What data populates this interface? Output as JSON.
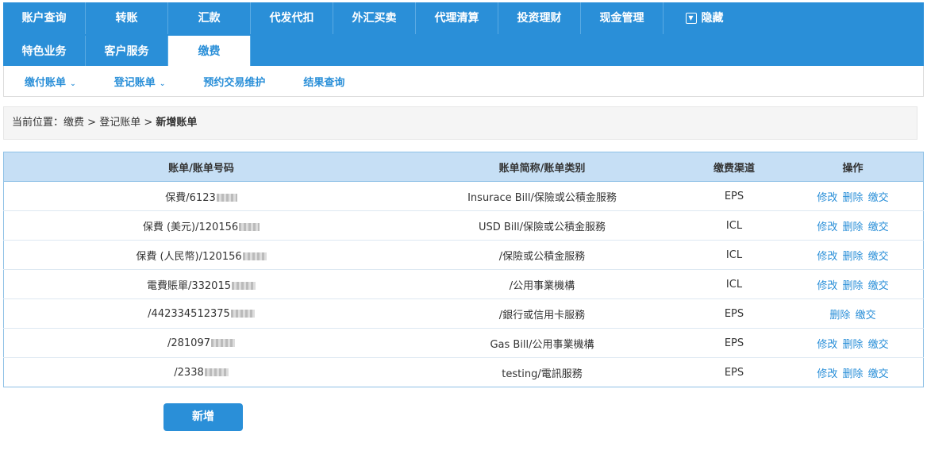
{
  "nav": {
    "row1": [
      "账户查询",
      "转账",
      "汇款",
      "代发代扣",
      "外汇买卖",
      "代理清算",
      "投资理财",
      "现金管理"
    ],
    "hide_label": "隐藏",
    "row2": [
      "特色业务",
      "客户服务",
      "缴费"
    ]
  },
  "subnav": [
    {
      "label": "缴付账单",
      "dropdown": true
    },
    {
      "label": "登记账单",
      "dropdown": true
    },
    {
      "label": "预约交易维护",
      "dropdown": false
    },
    {
      "label": "结果查询",
      "dropdown": false
    }
  ],
  "breadcrumb": {
    "prefix": "当前位置：",
    "crumbs": [
      "缴费",
      "登记账单"
    ],
    "separator": " > ",
    "current": "新增账单"
  },
  "table": {
    "headers": [
      "账单/账单号码",
      "账单简称/账单类别",
      "缴费渠道",
      "操作"
    ],
    "rows": [
      {
        "number": "保費/6123",
        "type": "Insurace Bill/保險或公積金服務",
        "channel": "EPS",
        "ops": [
          "修改",
          "删除",
          "缴交"
        ]
      },
      {
        "number": "保費 (美元)/120156",
        "type": "USD Bill/保險或公積金服務",
        "channel": "ICL",
        "ops": [
          "修改",
          "删除",
          "缴交"
        ]
      },
      {
        "number": "保費 (人民幣)/120156",
        "type": "/保險或公積金服務",
        "channel": "ICL",
        "ops": [
          "修改",
          "删除",
          "缴交"
        ]
      },
      {
        "number": "電費賬單/332015",
        "type": "/公用事業機構",
        "channel": "ICL",
        "ops": [
          "修改",
          "删除",
          "缴交"
        ]
      },
      {
        "number": "/442334512375",
        "type": "/銀行或信用卡服務",
        "channel": "EPS",
        "ops": [
          "删除",
          "缴交"
        ]
      },
      {
        "number": "/281097",
        "type": "Gas Bill/公用事業機構",
        "channel": "EPS",
        "ops": [
          "修改",
          "删除",
          "缴交"
        ]
      },
      {
        "number": "/2338",
        "type": "testing/電訊服務",
        "channel": "EPS",
        "ops": [
          "修改",
          "删除",
          "缴交"
        ]
      }
    ]
  },
  "add_button": "新增",
  "colors": {
    "primary": "#2a8fd8",
    "header_bg": "#c6dff5",
    "link": "#2a8fd8"
  }
}
